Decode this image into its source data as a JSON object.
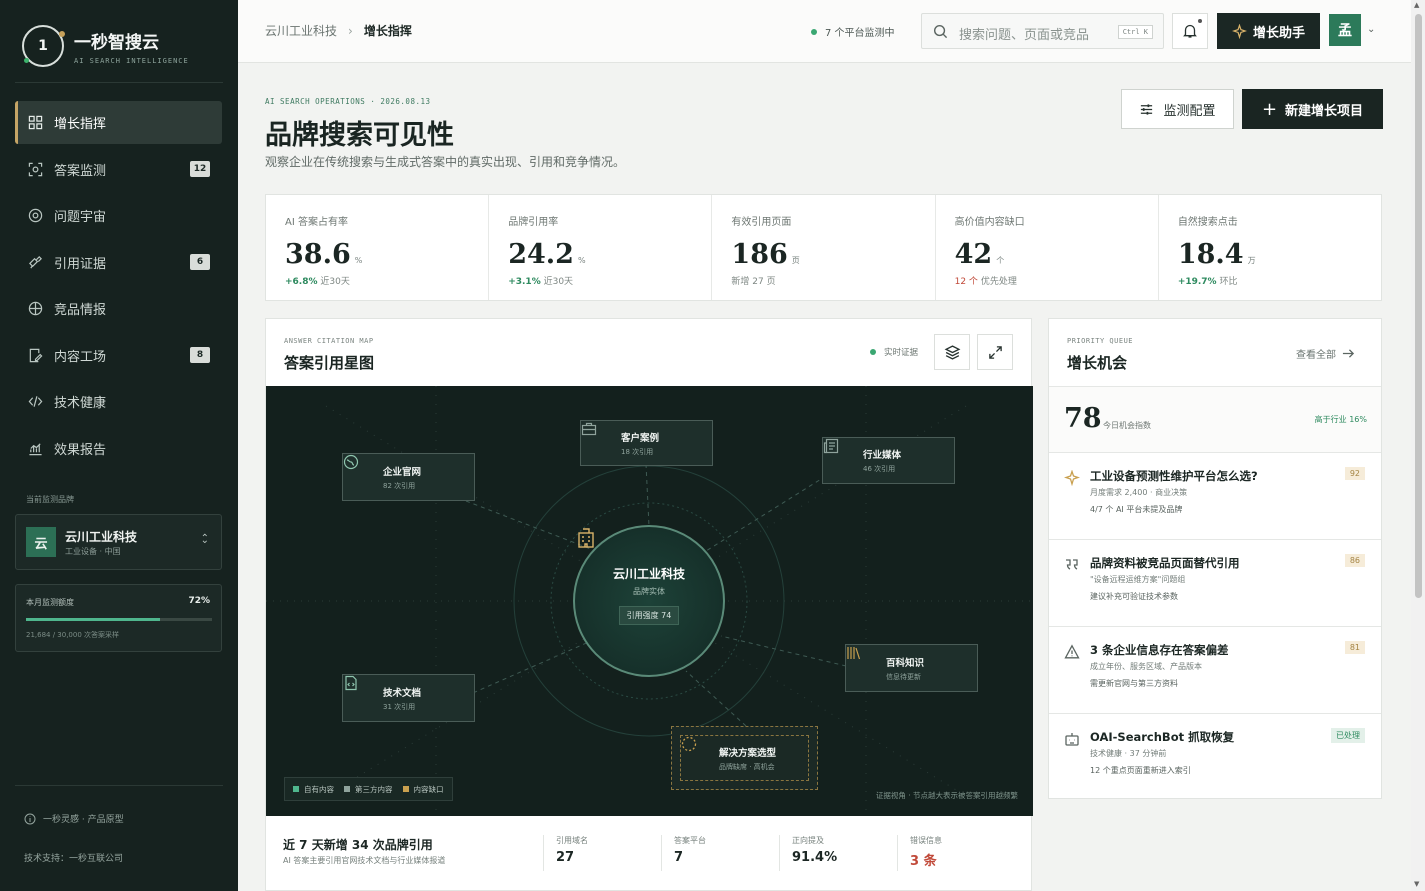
{
  "brand": {
    "logo_mark": "1",
    "title": "一秒智搜云",
    "subtitle": "AI SEARCH INTELLIGENCE"
  },
  "nav": [
    {
      "label": "增长指挥",
      "icon": "dashboard-icon",
      "active": true,
      "badge": ""
    },
    {
      "label": "答案监测",
      "icon": "scan-icon",
      "badge": "12"
    },
    {
      "label": "问题宇宙",
      "icon": "orbit-icon",
      "badge": ""
    },
    {
      "label": "引用证据",
      "icon": "link-icon",
      "badge": "6"
    },
    {
      "label": "竞品情报",
      "icon": "compass-icon",
      "badge": ""
    },
    {
      "label": "内容工场",
      "icon": "edit-doc-icon",
      "badge": "8"
    },
    {
      "label": "技术健康",
      "icon": "code-icon",
      "badge": ""
    },
    {
      "label": "效果报告",
      "icon": "chart-icon",
      "badge": ""
    }
  ],
  "current_brand": {
    "section_label": "当前监测品牌",
    "logo": "云",
    "name": "云川工业科技",
    "meta": "工业设备 · 中国"
  },
  "quota": {
    "label": "本月监测额度",
    "percent_text": "72%",
    "fraction": 0.72,
    "detail": "21,684 / 30,000 次答案采样"
  },
  "footer": {
    "line1": "一秒灵感 · 产品原型",
    "line2": "技术支持：一秒互联公司"
  },
  "topbar": {
    "breadcrumb_root": "云川工业科技",
    "breadcrumb_current": "增长指挥",
    "monitor_status": "7 个平台监测中",
    "search_placeholder": "搜索问题、页面或竞品",
    "search_shortcut": "Ctrl K",
    "assistant_label": "增长助手",
    "avatar": "孟"
  },
  "page": {
    "eyebrow": "AI SEARCH OPERATIONS · 2026.08.13",
    "title": "品牌搜索可见性",
    "description": "观察企业在传统搜索与生成式答案中的真实出现、引用和竞争情况。",
    "config_button": "监测配置",
    "new_button": "新建增长项目"
  },
  "kpis": [
    {
      "label": "AI 答案占有率",
      "value": "38.6",
      "unit": "%",
      "delta": "+6.8%",
      "note": "近30天",
      "delta_style": "green"
    },
    {
      "label": "品牌引用率",
      "value": "24.2",
      "unit": "%",
      "delta": "+3.1%",
      "note": "近30天",
      "delta_style": "green"
    },
    {
      "label": "有效引用页面",
      "value": "186",
      "unit": "页",
      "delta": "",
      "note": "新增 27 页",
      "delta_style": ""
    },
    {
      "label": "高价值内容缺口",
      "value": "42",
      "unit": "个",
      "delta": "12 个",
      "note": "优先处理",
      "delta_style": "red"
    },
    {
      "label": "自然搜索点击",
      "value": "18.4",
      "unit": "万",
      "delta": "+19.7%",
      "note": "环比",
      "delta_style": "green"
    }
  ],
  "map_card": {
    "eyebrow": "ANSWER CITATION MAP",
    "title": "答案引用星图",
    "live_label": "实时证据",
    "center": {
      "name": "云川工业科技",
      "type": "品牌实体",
      "pill": "引用强度 74"
    },
    "nodes": [
      {
        "name": "企业官网",
        "sub": "82 次引用",
        "icon": "globe-icon"
      },
      {
        "name": "客户案例",
        "sub": "18 次引用",
        "icon": "briefcase-icon"
      },
      {
        "name": "行业媒体",
        "sub": "46 次引用",
        "icon": "newspaper-icon"
      },
      {
        "name": "技术文档",
        "sub": "31 次引用",
        "icon": "code-doc-icon"
      },
      {
        "name": "百科知识",
        "sub": "信息待更新",
        "icon": "books-icon"
      },
      {
        "name": "解决方案选型",
        "sub": "品牌缺席 · 高机会",
        "icon": "loading-circle-icon"
      }
    ],
    "legend": [
      {
        "label": "自有内容",
        "color": "#4fb68d"
      },
      {
        "label": "第三方内容",
        "color": "#8fa39c"
      },
      {
        "label": "内容缺口",
        "color": "#c9a04f"
      }
    ],
    "note": "证据视角 · 节点越大表示被答案引用越频繁",
    "footer_title": "近 7 天新增 34 次品牌引用",
    "footer_sub": "AI 答案主要引用官网技术文档与行业媒体报道",
    "stats": [
      {
        "label": "引用域名",
        "value": "27"
      },
      {
        "label": "答案平台",
        "value": "7"
      },
      {
        "label": "正向提及",
        "value": "91.4%"
      },
      {
        "label": "错误信息",
        "value": "3 条"
      }
    ]
  },
  "opportunities": {
    "eyebrow": "PRIORITY QUEUE",
    "title": "增长机会",
    "view_all": "查看全部",
    "score": "78",
    "score_label": "今日机会指数",
    "score_rank": "高于行业 16%",
    "items": [
      {
        "title": "工业设备预测性维护平台怎么选?",
        "meta": "月度需求 2,400 · 商业决策",
        "desc": "4/7 个 AI 平台未提及品牌",
        "badge": "92",
        "icon": "sparkle-icon"
      },
      {
        "title": "品牌资料被竞品页面替代引用",
        "meta": "\"设备远程运维方案\"问题组",
        "desc": "建议补充可验证技术参数",
        "badge": "86",
        "icon": "quote-icon"
      },
      {
        "title": "3 条企业信息存在答案偏差",
        "meta": "成立年份、服务区域、产品版本",
        "desc": "需更新官网与第三方资料",
        "badge": "81",
        "icon": "warning-icon"
      },
      {
        "title": "OAI-SearchBot 抓取恢复",
        "meta": "技术健康 · 37 分钟前",
        "desc": "12 个重点页面重新进入索引",
        "badge": "已处理",
        "icon": "bot-icon"
      }
    ]
  }
}
